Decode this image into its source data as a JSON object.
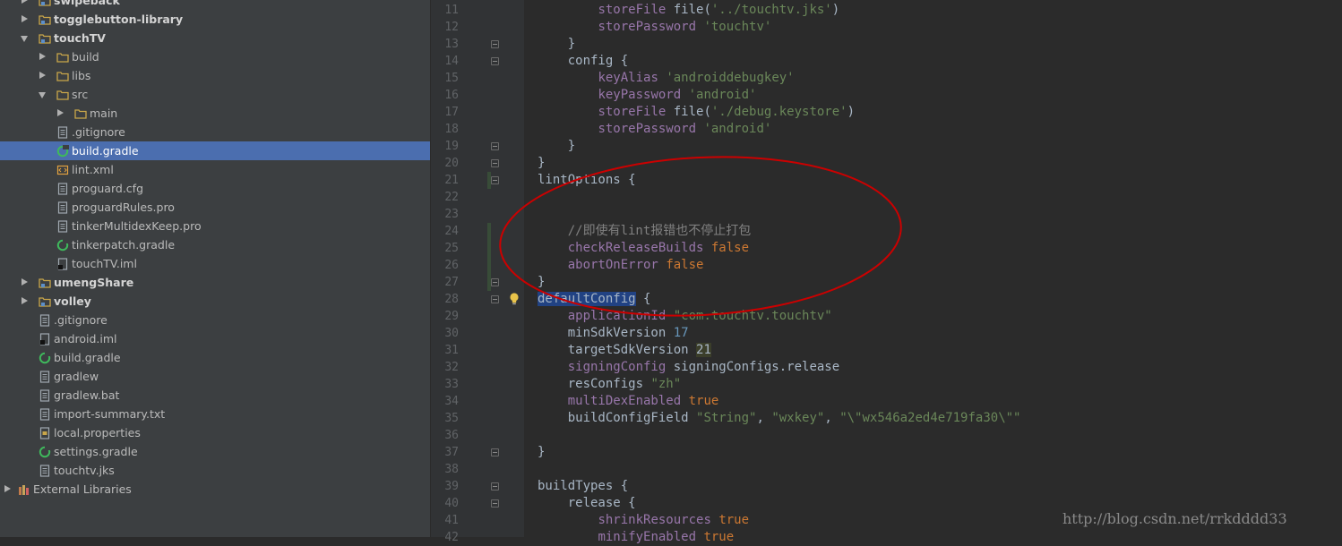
{
  "project_tree": {
    "items": [
      {
        "label": "swipeback",
        "icon": "module-folder-icon",
        "bold": true,
        "arrow": "right",
        "depth": 0
      },
      {
        "label": "togglebutton-library",
        "icon": "module-folder-icon",
        "bold": true,
        "arrow": "right",
        "depth": 0
      },
      {
        "label": "touchTV",
        "icon": "module-folder-icon",
        "bold": true,
        "arrow": "down",
        "depth": 0
      },
      {
        "label": "build",
        "icon": "folder-icon",
        "arrow": "right",
        "depth": 1
      },
      {
        "label": "libs",
        "icon": "folder-icon",
        "arrow": "right",
        "depth": 1
      },
      {
        "label": "src",
        "icon": "folder-icon",
        "arrow": "down",
        "depth": 1
      },
      {
        "label": "main",
        "icon": "folder-icon",
        "arrow": "right",
        "depth": 2
      },
      {
        "label": ".gitignore",
        "icon": "text-file-icon",
        "depth": 1
      },
      {
        "label": "build.gradle",
        "icon": "gradle-icon",
        "depth": 1,
        "selected": true
      },
      {
        "label": "lint.xml",
        "icon": "xml-file-icon",
        "depth": 1
      },
      {
        "label": "proguard.cfg",
        "icon": "text-file-icon",
        "depth": 1
      },
      {
        "label": "proguardRules.pro",
        "icon": "text-file-icon",
        "depth": 1
      },
      {
        "label": "tinkerMultidexKeep.pro",
        "icon": "text-file-icon",
        "depth": 1
      },
      {
        "label": "tinkerpatch.gradle",
        "icon": "gradle-icon",
        "depth": 1
      },
      {
        "label": "touchTV.iml",
        "icon": "iml-file-icon",
        "depth": 1
      },
      {
        "label": "umengShare",
        "icon": "module-folder-icon",
        "bold": true,
        "arrow": "right",
        "depth": 0
      },
      {
        "label": "volley",
        "icon": "module-folder-icon",
        "bold": true,
        "arrow": "right",
        "depth": 0
      },
      {
        "label": ".gitignore",
        "icon": "text-file-icon",
        "depth": 0
      },
      {
        "label": "android.iml",
        "icon": "iml-file-icon",
        "depth": 0
      },
      {
        "label": "build.gradle",
        "icon": "gradle-icon",
        "depth": 0
      },
      {
        "label": "gradlew",
        "icon": "text-file-icon",
        "depth": 0
      },
      {
        "label": "gradlew.bat",
        "icon": "text-file-icon",
        "depth": 0
      },
      {
        "label": "import-summary.txt",
        "icon": "text-file-icon",
        "depth": 0
      },
      {
        "label": "local.properties",
        "icon": "properties-file-icon",
        "depth": 0
      },
      {
        "label": "settings.gradle",
        "icon": "gradle-icon",
        "depth": 0
      },
      {
        "label": "touchtv.jks",
        "icon": "text-file-icon",
        "depth": 0
      },
      {
        "label": "External Libraries",
        "icon": "library-icon",
        "arrow": "right",
        "depth": -1
      }
    ]
  },
  "editor": {
    "first_line": 11,
    "lines": [
      [
        {
          "t": "        "
        },
        {
          "t": "storeFile",
          "c": "p"
        },
        {
          "t": " file("
        },
        {
          "t": "'../touchtv.jks'",
          "c": "s"
        },
        {
          "t": ")"
        }
      ],
      [
        {
          "t": "        "
        },
        {
          "t": "storePassword",
          "c": "p"
        },
        {
          "t": " "
        },
        {
          "t": "'touchtv'",
          "c": "s"
        }
      ],
      [
        {
          "t": "    }"
        }
      ],
      [
        {
          "t": "    config {"
        }
      ],
      [
        {
          "t": "        "
        },
        {
          "t": "keyAlias",
          "c": "p"
        },
        {
          "t": " "
        },
        {
          "t": "'androiddebugkey'",
          "c": "s"
        }
      ],
      [
        {
          "t": "        "
        },
        {
          "t": "keyPassword",
          "c": "p"
        },
        {
          "t": " "
        },
        {
          "t": "'android'",
          "c": "s"
        }
      ],
      [
        {
          "t": "        "
        },
        {
          "t": "storeFile",
          "c": "p"
        },
        {
          "t": " file("
        },
        {
          "t": "'./debug.keystore'",
          "c": "s"
        },
        {
          "t": ")"
        }
      ],
      [
        {
          "t": "        "
        },
        {
          "t": "storePassword",
          "c": "p"
        },
        {
          "t": " "
        },
        {
          "t": "'android'",
          "c": "s"
        }
      ],
      [
        {
          "t": "    }"
        }
      ],
      [
        {
          "t": "}"
        }
      ],
      [
        {
          "t": "lintOptions {"
        }
      ],
      [],
      [],
      [
        {
          "t": "    "
        },
        {
          "t": "//即使有lint报错也不停止打包",
          "c": "c"
        }
      ],
      [
        {
          "t": "    "
        },
        {
          "t": "checkReleaseBuilds",
          "c": "p"
        },
        {
          "t": " "
        },
        {
          "t": "false",
          "c": "k"
        }
      ],
      [
        {
          "t": "    "
        },
        {
          "t": "abortOnError",
          "c": "p"
        },
        {
          "t": " "
        },
        {
          "t": "false",
          "c": "k"
        }
      ],
      [
        {
          "t": "}"
        }
      ],
      [
        {
          "t": "defaultConfig",
          "c": "hl"
        },
        {
          "t": " {"
        }
      ],
      [
        {
          "t": "    "
        },
        {
          "t": "applicationId",
          "c": "p"
        },
        {
          "t": " "
        },
        {
          "t": "\"com.touchtv.touchtv\"",
          "c": "s"
        }
      ],
      [
        {
          "t": "    minSdkVersion "
        },
        {
          "t": "17",
          "c": "n"
        }
      ],
      [
        {
          "t": "    targetSdkVersion "
        },
        {
          "t": "21",
          "c": "nh"
        }
      ],
      [
        {
          "t": "    "
        },
        {
          "t": "signingConfig",
          "c": "p"
        },
        {
          "t": " signingConfigs.release"
        }
      ],
      [
        {
          "t": "    resConfigs "
        },
        {
          "t": "\"zh\"",
          "c": "s"
        }
      ],
      [
        {
          "t": "    "
        },
        {
          "t": "multiDexEnabled",
          "c": "p"
        },
        {
          "t": " "
        },
        {
          "t": "true",
          "c": "k"
        }
      ],
      [
        {
          "t": "    buildConfigField "
        },
        {
          "t": "\"String\"",
          "c": "s"
        },
        {
          "t": ", "
        },
        {
          "t": "\"wxkey\"",
          "c": "s"
        },
        {
          "t": ", "
        },
        {
          "t": "\"\\\"wx546a2ed4e719fa30\\\"\"",
          "c": "s"
        }
      ],
      [],
      [
        {
          "t": "}"
        }
      ],
      [],
      [
        {
          "t": "buildTypes {"
        }
      ],
      [
        {
          "t": "    release {"
        }
      ],
      [
        {
          "t": "        "
        },
        {
          "t": "shrinkResources",
          "c": "p"
        },
        {
          "t": " "
        },
        {
          "t": "true",
          "c": "k"
        }
      ],
      [
        {
          "t": "        "
        },
        {
          "t": "minifyEnabled",
          "c": "p"
        },
        {
          "t": " "
        },
        {
          "t": "true",
          "c": "k"
        }
      ]
    ],
    "fold_lines": [
      13,
      14,
      19,
      20,
      21,
      27,
      28,
      37,
      39,
      40
    ],
    "changed_lines": [
      21,
      24,
      25,
      26,
      27
    ],
    "bulb_line": 28
  },
  "watermark": "http://blog.csdn.net/rrkdddd33",
  "colors": {
    "annotation": "#cc0000",
    "selection": "#4b6eaf"
  }
}
